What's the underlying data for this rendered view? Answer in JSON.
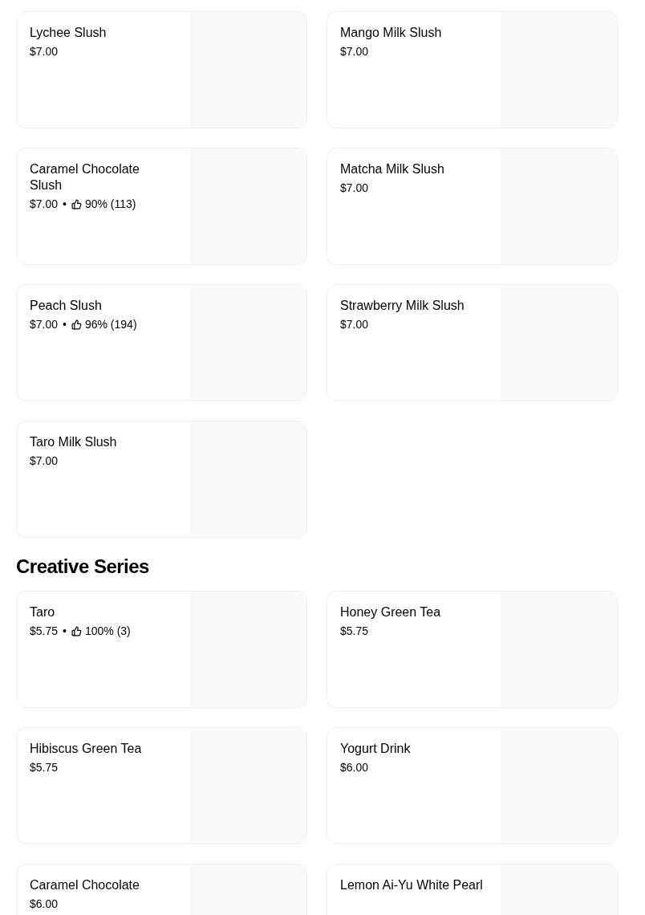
{
  "sections": [
    {
      "items": [
        {
          "name": "Lychee Slush",
          "price": "$7.00"
        },
        {
          "name": "Mango Milk Slush",
          "price": "$7.00"
        },
        {
          "name": "Caramel Chocolate Slush",
          "price": "$7.00",
          "separator": "•",
          "rating": "90% (113)"
        },
        {
          "name": "Matcha Milk Slush",
          "price": "$7.00"
        },
        {
          "name": "Peach Slush",
          "price": "$7.00",
          "separator": "•",
          "rating": "96% (194)"
        },
        {
          "name": "Strawberry Milk Slush",
          "price": "$7.00"
        },
        {
          "name": "Taro Milk Slush",
          "price": "$7.00"
        }
      ]
    },
    {
      "title": "Creative Series",
      "items": [
        {
          "name": "Taro",
          "price": "$5.75",
          "separator": "•",
          "rating": "100% (3)"
        },
        {
          "name": "Honey Green Tea",
          "price": "$5.75"
        },
        {
          "name": "Hibiscus Green Tea",
          "price": "$5.75"
        },
        {
          "name": "Yogurt Drink",
          "price": "$6.00"
        },
        {
          "name": "Caramel Chocolate",
          "price": "$6.00"
        },
        {
          "name": "Lemon Ai-Yu White Pearl"
        }
      ]
    }
  ]
}
